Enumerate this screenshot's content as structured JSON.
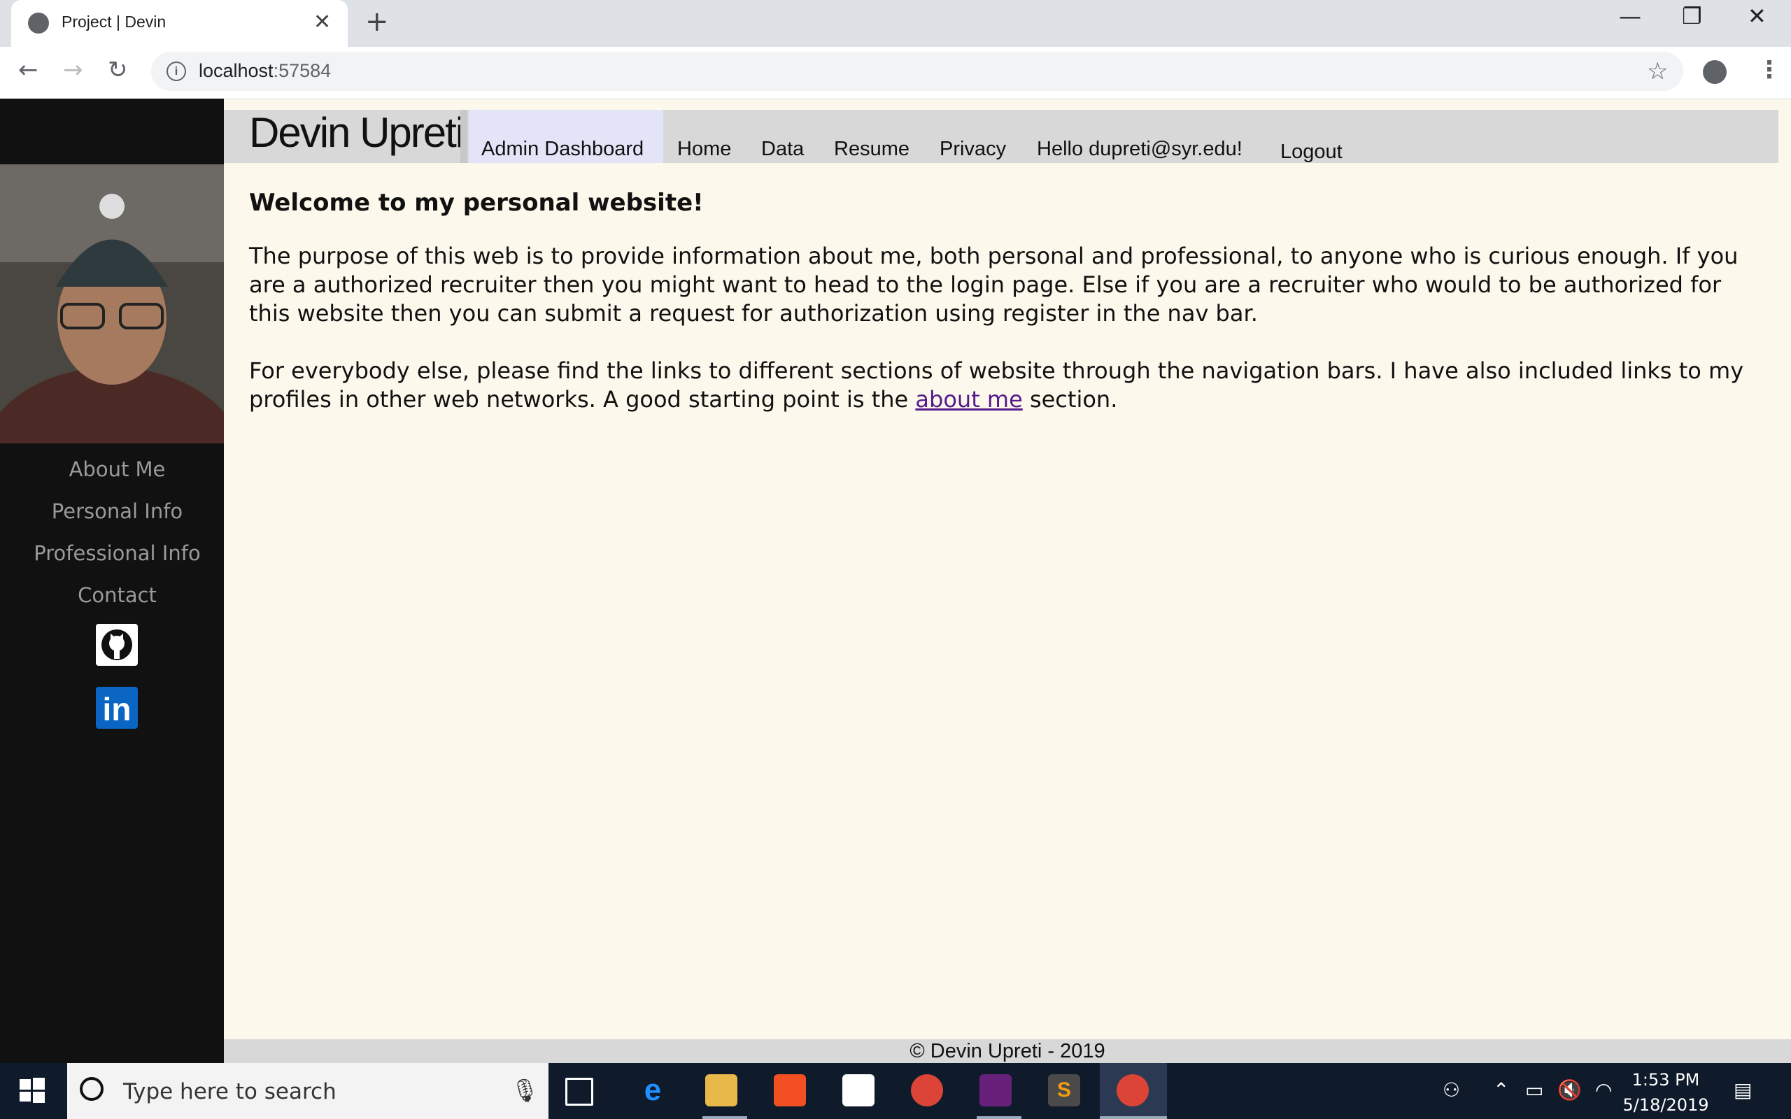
{
  "browser": {
    "tab_title": "Project | Devin",
    "new_tab": "+",
    "close_tab": "✕",
    "minimize": "—",
    "restore": "❐",
    "close_window": "✕",
    "back": "←",
    "forward": "→",
    "reload": "↻",
    "url_host": "localhost",
    "url_port": ":57584",
    "bookmark": "☆",
    "menu": "⋮",
    "info": "i"
  },
  "sidebar": {
    "links": [
      {
        "label": "About Me"
      },
      {
        "label": "Personal Info"
      },
      {
        "label": "Professional Info"
      },
      {
        "label": "Contact"
      }
    ],
    "linkedin_label": "in"
  },
  "header": {
    "brand": "Devin Upreti",
    "nav": [
      {
        "label": "Admin Dashboard"
      },
      {
        "label": "Home"
      },
      {
        "label": "Data"
      },
      {
        "label": "Resume"
      },
      {
        "label": "Privacy"
      },
      {
        "label": "Hello dupreti@syr.edu!"
      },
      {
        "label": "Logout"
      }
    ]
  },
  "content": {
    "heading": "Welcome to my personal website!",
    "para1": "The purpose of this web is to provide information about me, both personal and professional, to anyone who is curious enough. If you are a authorized recruiter then you might want to head to the login page. Else if you are a recruiter who would to be authorized for this website then you can submit a request for authorization using register in the nav bar.",
    "para2_before": "For everybody else, please find the links to different sections of website through the navigation bars. I have also included links to my profiles in other web networks. A good starting point is the ",
    "para2_link": "about me",
    "para2_after": " section."
  },
  "footer": {
    "text": "© Devin Upreti - 2019"
  },
  "taskbar": {
    "search_placeholder": "Type here to search",
    "time": "1:53 PM",
    "date": "5/18/2019",
    "apps": [
      "task-view-icon",
      "edge-icon",
      "file-explorer-icon",
      "store-icon",
      "mail-icon",
      "chrome-icon",
      "visual-studio-icon",
      "sublime-icon",
      "chrome-icon"
    ]
  }
}
